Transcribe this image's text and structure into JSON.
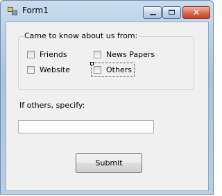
{
  "window": {
    "title": "Form1",
    "close_glyph": "✕",
    "icons": [
      "app-icon",
      "minimize-icon",
      "maximize-icon",
      "close-icon"
    ]
  },
  "form": {
    "group_label": "Came to know about us from:",
    "options": [
      {
        "label": "Friends",
        "checked": false
      },
      {
        "label": "News Papers",
        "checked": false
      },
      {
        "label": "Website",
        "checked": false
      },
      {
        "label": "Others",
        "checked": false
      }
    ],
    "specify_label": "If others, specify:",
    "specify_value": "",
    "submit_label": "Submit"
  }
}
